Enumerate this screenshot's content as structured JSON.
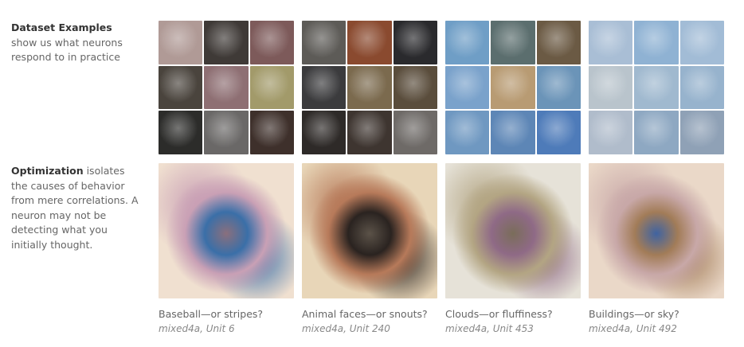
{
  "side_dataset": {
    "bold": "Dataset Examples",
    "rest": " show us what neurons respond to in practice"
  },
  "side_optimization": {
    "bold": "Optimization",
    "rest": " isolates the causes of behavior from mere correlations. A neuron may not be detecting what you initially thought."
  },
  "columns": [
    {
      "caption": "Baseball—or stripes?",
      "unit": "mixed4a, Unit 6",
      "tile_colors": [
        "#b09a96",
        "#3f3a37",
        "#7d5a5a",
        "#4a443d",
        "#8e6f73",
        "#a29a6a",
        "#2c2c2a",
        "#6a6867",
        "#3e302b"
      ],
      "opt_colors": [
        "#f0e0d0",
        "#8a6f7d",
        "#3a6fa8",
        "#c9a0b5"
      ]
    },
    {
      "caption": "Animal faces—or snouts?",
      "unit": "mixed4a, Unit 240",
      "tile_colors": [
        "#5d5b57",
        "#8a4a2f",
        "#2a2a2d",
        "#3b3b3d",
        "#7b6a4e",
        "#5a4d3c",
        "#2e2a28",
        "#3e3530",
        "#6e6a67"
      ],
      "opt_colors": [
        "#e8d6b8",
        "#5b5248",
        "#2a2320",
        "#b77a5a"
      ]
    },
    {
      "caption": "Clouds—or fluffiness?",
      "unit": "mixed4a, Unit 453",
      "tile_colors": [
        "#6f9ec6",
        "#5b6e6e",
        "#6b5a44",
        "#7aa2cb",
        "#b89b73",
        "#6b94b8",
        "#6f98c1",
        "#5d86b6",
        "#4e7bb9"
      ],
      "opt_colors": [
        "#e6e2d8",
        "#7a6d5a",
        "#8f6a86",
        "#b3a583"
      ]
    },
    {
      "caption": "Buildings—or sky?",
      "unit": "mixed4a, Unit 492",
      "tile_colors": [
        "#a9bed5",
        "#8fb2d3",
        "#a2bcd6",
        "#b9c4cc",
        "#a0b9cf",
        "#97b3cd",
        "#b0bccb",
        "#8ea8c2",
        "#8fa1b6"
      ],
      "opt_colors": [
        "#ead8c8",
        "#3f63a1",
        "#a27c58",
        "#c8a8a8"
      ]
    }
  ]
}
